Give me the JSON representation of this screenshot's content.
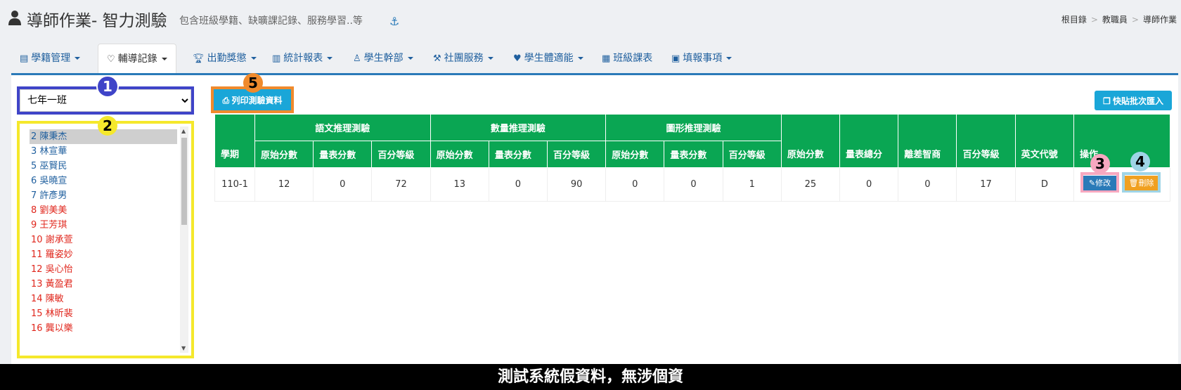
{
  "header": {
    "title": "導師作業- 智力測驗",
    "subtitle": "包含班級學籍、缺曠課記錄、服務學習..等",
    "breadcrumb": [
      "根目錄",
      "教職員",
      "導師作業"
    ]
  },
  "nav": {
    "tabs": [
      {
        "label": "學籍管理",
        "icon": "id-card-icon"
      },
      {
        "label": "輔導記錄",
        "icon": "heart-icon"
      },
      {
        "label": "出勤獎懲",
        "icon": "trophy-icon"
      },
      {
        "label": "統計報表",
        "icon": "bar-chart-icon"
      },
      {
        "label": "學生幹部",
        "icon": "person-icon"
      },
      {
        "label": "社團服務",
        "icon": "tools-icon"
      },
      {
        "label": "學生體適能",
        "icon": "heartbeat-icon"
      },
      {
        "label": "班級課表",
        "icon": "table-icon"
      },
      {
        "label": "填報事項",
        "icon": "form-icon"
      }
    ],
    "active": "輔導記錄"
  },
  "class_select": {
    "value": "七年一班"
  },
  "students": [
    {
      "text": "2 陳秉杰",
      "color": "#1f5f9e",
      "selected": true
    },
    {
      "text": "3 林宣華",
      "color": "#1f5f9e"
    },
    {
      "text": "5 巫賢民",
      "color": "#1f5f9e"
    },
    {
      "text": "6 吳曉宣",
      "color": "#1f5f9e"
    },
    {
      "text": "7 許彥男",
      "color": "#1f5f9e"
    },
    {
      "text": "8 劉美美",
      "color": "#e0271d"
    },
    {
      "text": "9 王芳琪",
      "color": "#e0271d"
    },
    {
      "text": "10 謝承萱",
      "color": "#e0271d"
    },
    {
      "text": "11 羅姿妙",
      "color": "#e0271d"
    },
    {
      "text": "12 吳心怡",
      "color": "#e0271d"
    },
    {
      "text": "13 黃盈君",
      "color": "#e0271d"
    },
    {
      "text": "14 陳敏",
      "color": "#e0271d"
    },
    {
      "text": "15 林昕裴",
      "color": "#e0271d"
    },
    {
      "text": "16 龔以樂",
      "color": "#e0271d"
    }
  ],
  "buttons": {
    "print": "列印測驗資料",
    "paste": "快貼批次匯入",
    "edit": "修改",
    "delete": "刪除"
  },
  "table": {
    "group_headers": [
      "語文推理測驗",
      "數量推理測驗",
      "圖形推理測驗"
    ],
    "col_term": "學期",
    "sub_headers": [
      "原始分數",
      "量表分數",
      "百分等級",
      "原始分數",
      "量表分數",
      "百分等級",
      "原始分數",
      "量表分數",
      "百分等級"
    ],
    "tail_headers": [
      "原始分數",
      "量表總分",
      "離差智商",
      "百分等級",
      "英文代號",
      "操作"
    ],
    "rows": [
      [
        "110-1",
        "12",
        "0",
        "72",
        "13",
        "0",
        "90",
        "0",
        "0",
        "1",
        "25",
        "0",
        "0",
        "17",
        "D"
      ]
    ]
  },
  "badges": [
    "1",
    "2",
    "3",
    "4",
    "5"
  ],
  "footer": "測試系統假資料，無涉個資"
}
